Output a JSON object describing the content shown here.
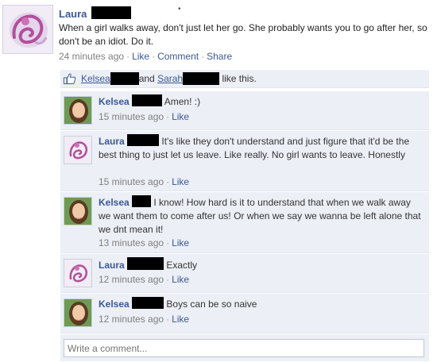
{
  "post": {
    "author": "Laura",
    "text": "When a girl walks away, don't just let her go. She probably wants you to go after her, so don't be an idiot. Do it.",
    "time": "24 minutes ago",
    "like_label": "Like",
    "comment_label": "Comment",
    "share_label": "Share",
    "stray_mark": "•"
  },
  "likes": {
    "name1": "Kelsea",
    "and_text": "and",
    "name2": "Sarah",
    "suffix": "like this."
  },
  "comments": [
    {
      "author": "Kelsea",
      "text": "Amen! :)",
      "time": "15 minutes ago",
      "like_label": "Like"
    },
    {
      "author": "Laura",
      "text": "It's like they don't understand and just figure that it'd be the best thing to just let us leave. Like really. No girl wants to leave. Honestly",
      "time": "15 minutes ago",
      "like_label": "Like"
    },
    {
      "author": "Kelsea",
      "text": "I know! How hard is it to understand that when we walk away we want them to come after us! Or when we say we wanna be left alone that we dnt mean it!",
      "time": "13 minutes ago",
      "like_label": "Like"
    },
    {
      "author": "Laura",
      "text": "Exactly",
      "time": "12 minutes ago",
      "like_label": "Like"
    },
    {
      "author": "Kelsea",
      "text": "Boys can be so naive",
      "time": "12 minutes ago",
      "like_label": "Like"
    }
  ],
  "compose": {
    "placeholder": "Write a comment..."
  },
  "colors": {
    "link": "#3b5998",
    "feedback_bg": "#eceff5",
    "meta": "#7f7f7f"
  },
  "icons": {
    "like": "thumbs-up-icon"
  }
}
